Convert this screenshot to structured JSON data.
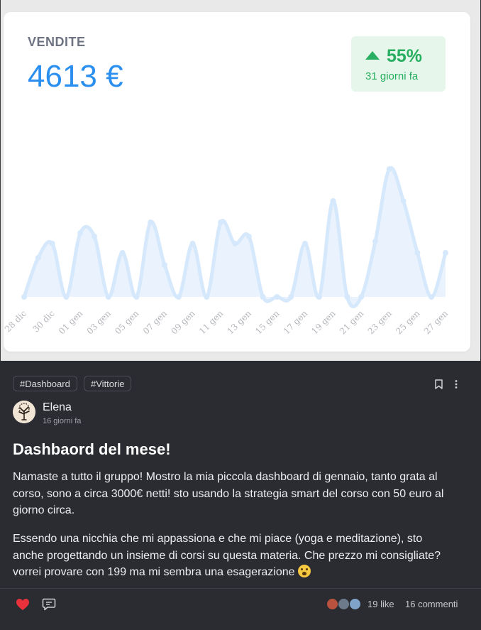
{
  "dashboard": {
    "label": "VENDITE",
    "amount": "4613 €",
    "delta_pct": "55%",
    "delta_sub": "31 giorni fa",
    "accent_color": "#2b8ff0",
    "positive_color": "#27ae60"
  },
  "chart_data": {
    "type": "area",
    "title": "",
    "xlabel": "",
    "ylabel": "",
    "grid": false,
    "legend": "none",
    "tick_labels": [
      "28 dic",
      "30 dic",
      "01 gen",
      "03 gen",
      "05 gen",
      "07 gen",
      "09 gen",
      "11 gen",
      "13 gen",
      "15 gen",
      "17 gen",
      "19 gen",
      "21 gen",
      "23 gen",
      "25 gen",
      "27 gen"
    ],
    "values": [
      0,
      55,
      75,
      0,
      90,
      85,
      0,
      62,
      0,
      105,
      45,
      0,
      75,
      0,
      105,
      75,
      85,
      0,
      0,
      0,
      75,
      0,
      135,
      0,
      0,
      78,
      180,
      135,
      62,
      0,
      62
    ],
    "ylim": [
      0,
      200
    ]
  },
  "post": {
    "tags": [
      "#Dashboard",
      "#Vittorie"
    ],
    "author": "Elena",
    "time_ago": "16 giorni fa",
    "title": "Dashbaord del mese!",
    "paragraph1": "Namaste a tutto il gruppo! Mostro la mia piccola dashboard di gennaio, tanto grata al corso, sono a circa 3000€ netti! sto usando la strategia smart del corso con 50 euro al giorno circa.",
    "paragraph2": "Essendo una nicchia che mi appassiona e che mi piace (yoga e meditazione), sto anche progettando un insieme di corsi su questa materia. Che prezzo mi consigliate? vorrei provare con 199 ma mi sembra una esagerazione",
    "likes": "19 like",
    "comments": "16 commenti",
    "icons": [
      "bookmark-icon",
      "more-vertical-icon",
      "heart-icon",
      "comment-icon",
      "emoji-icon"
    ]
  }
}
